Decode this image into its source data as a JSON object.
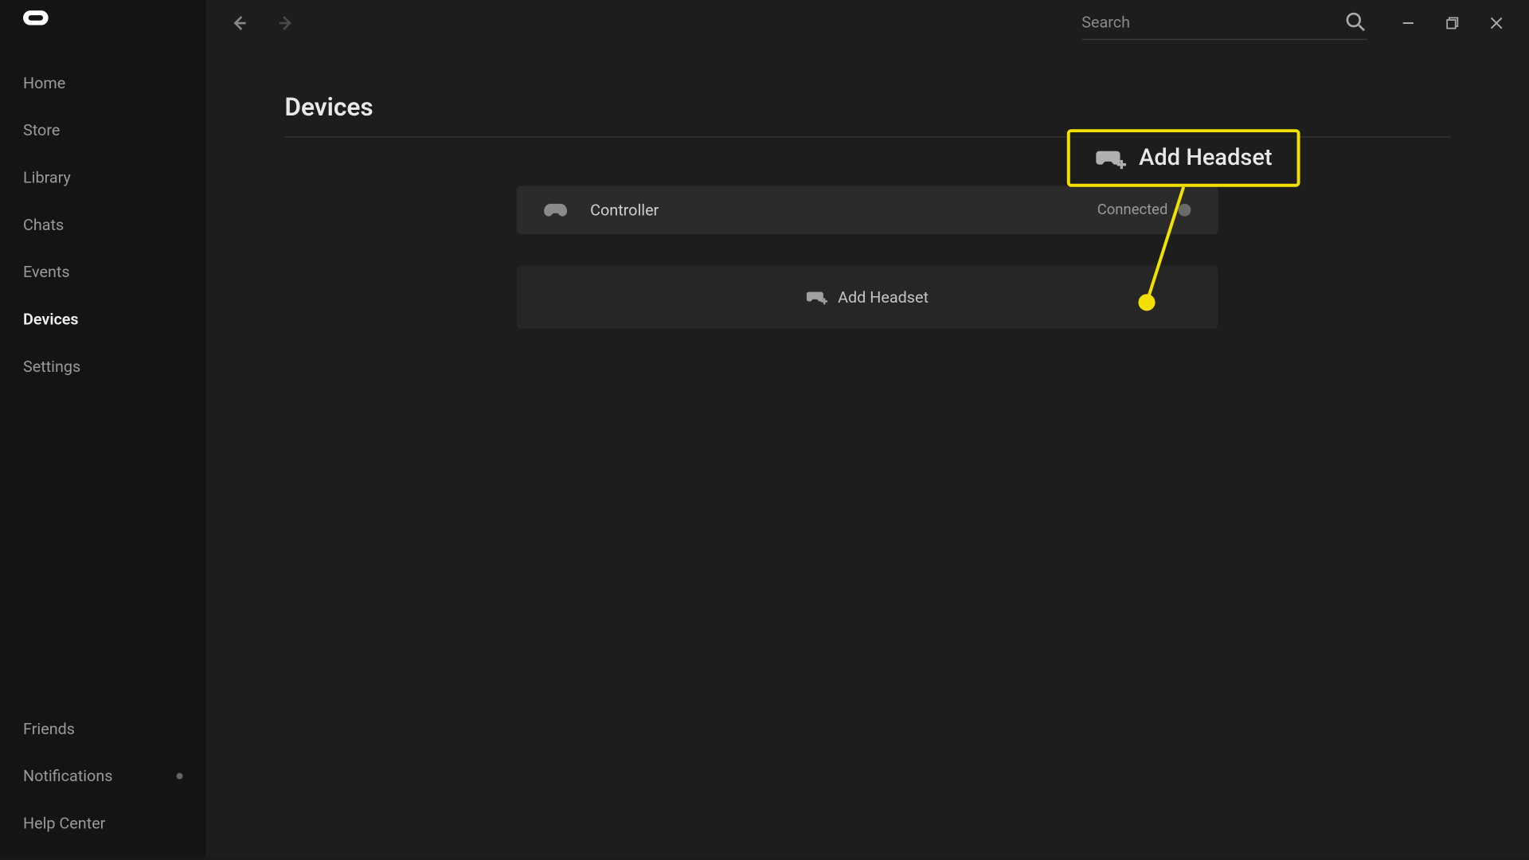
{
  "sidebar": {
    "nav_top": [
      {
        "label": "Home"
      },
      {
        "label": "Store"
      },
      {
        "label": "Library"
      },
      {
        "label": "Chats"
      },
      {
        "label": "Events"
      },
      {
        "label": "Devices"
      },
      {
        "label": "Settings"
      }
    ],
    "nav_bottom": [
      {
        "label": "Friends"
      },
      {
        "label": "Notifications"
      },
      {
        "label": "Help Center"
      }
    ]
  },
  "search": {
    "placeholder": "Search"
  },
  "page": {
    "title": "Devices"
  },
  "device": {
    "label": "Controller",
    "status": "Connected"
  },
  "add_headset": {
    "label": "Add Headset"
  },
  "callout": {
    "label": "Add Headset"
  }
}
